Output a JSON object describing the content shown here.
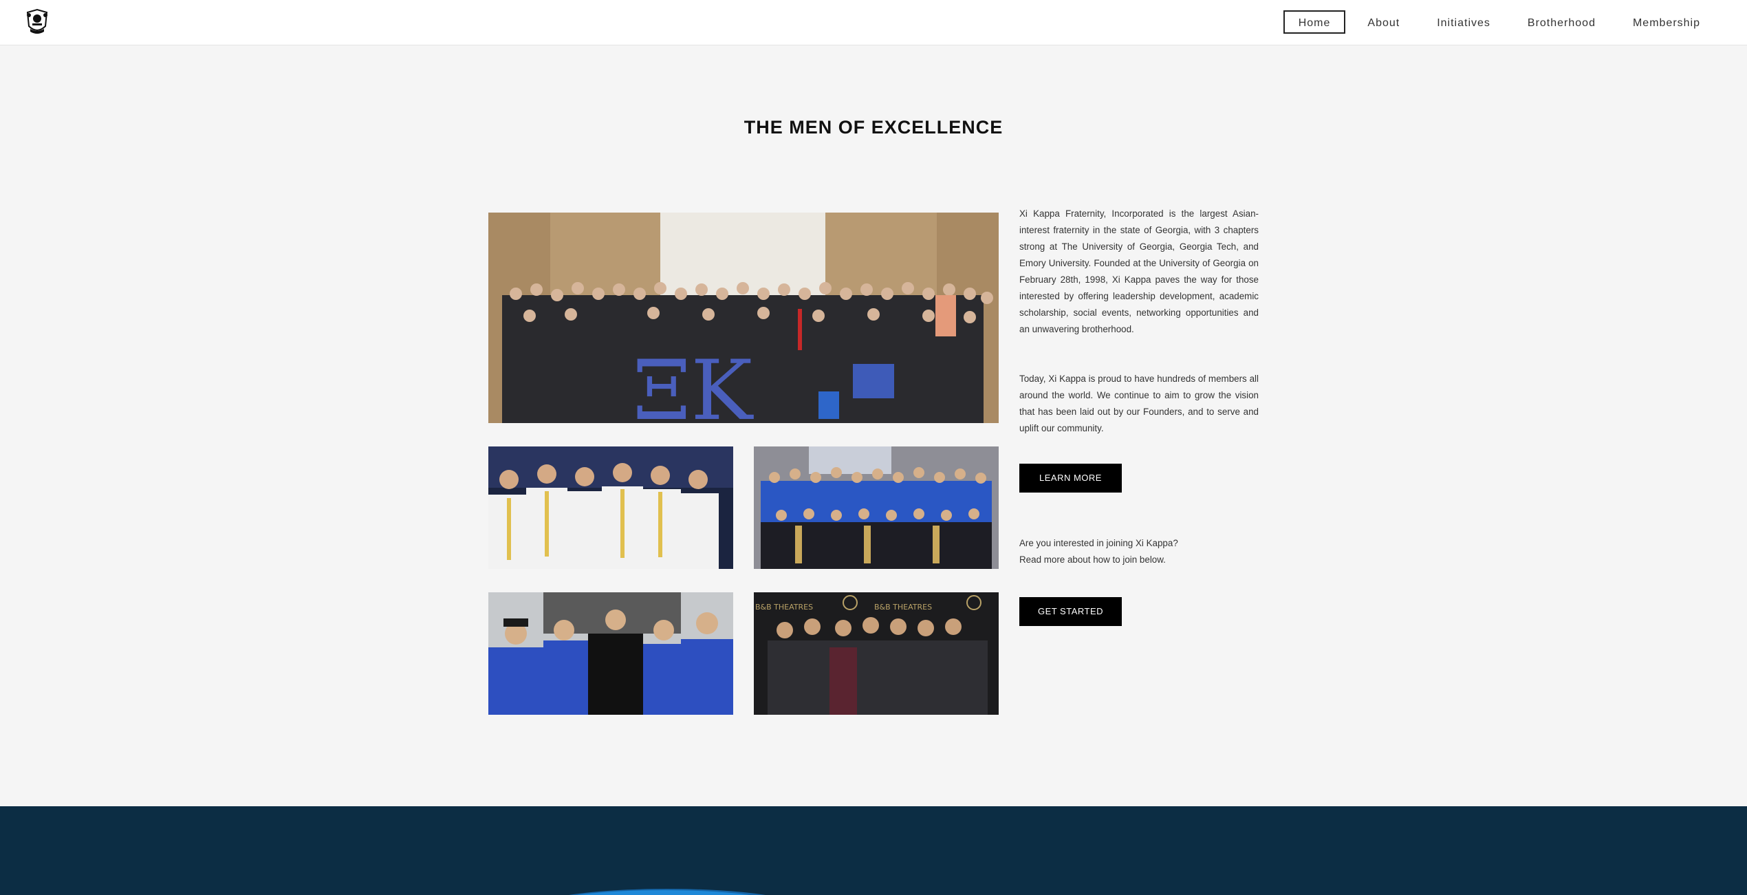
{
  "nav": {
    "items": [
      {
        "label": "Home",
        "active": true
      },
      {
        "label": "About",
        "active": false
      },
      {
        "label": "Initiatives",
        "active": false
      },
      {
        "label": "Brotherhood",
        "active": false
      },
      {
        "label": "Membership",
        "active": false
      }
    ]
  },
  "main": {
    "title": "THE MEN OF EXCELLENCE",
    "paragraph1": "Xi Kappa Fraternity, Incorporated is the largest Asian-interest fraternity in the state of Georgia, with 3 chapters strong at The University of Georgia, Georgia Tech, and Emory University. Founded at the University of Georgia on February 28th, 1998, Xi Kappa paves the way for those interested by offering leadership development, academic scholarship, social events, networking opportunities and an unwavering brotherhood.",
    "paragraph2": "Today, Xi Kappa is proud to have hundreds of members all around the world. We continue to aim to grow the vision that has been laid out by our Founders, and to serve and uplift our community.",
    "learn_more": "LEARN MORE",
    "join_line1": "Are you interested in joining Xi Kappa?",
    "join_line2": "Read more about how to join below.",
    "get_started": "GET STARTED"
  },
  "photos": {
    "main_letters": "ΞK",
    "theatre_sign": "B&B THEATRES"
  },
  "colors": {
    "nav_bg": "#ffffff",
    "page_bg": "#f5f5f5",
    "button_bg": "#000000",
    "footer_band": "#0c2d44",
    "accent_blue": "#1e88d8"
  }
}
